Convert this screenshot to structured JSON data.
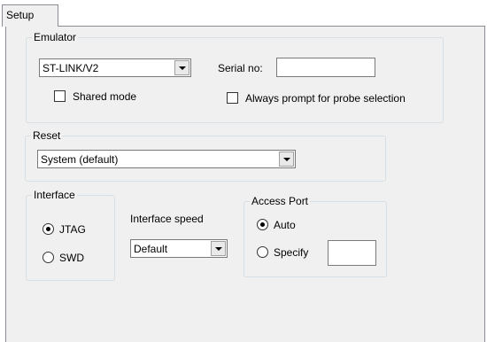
{
  "tab": {
    "label": "Setup"
  },
  "emulator": {
    "legend": "Emulator",
    "probe_value": "ST-LINK/V2",
    "serial_label": "Serial no:",
    "serial_value": "",
    "shared_mode_label": "Shared mode",
    "shared_mode_checked": false,
    "always_prompt_label": "Always prompt for probe selection",
    "always_prompt_checked": false
  },
  "reset": {
    "legend": "Reset",
    "value": "System (default)"
  },
  "interface": {
    "legend": "Interface",
    "options": [
      "JTAG",
      "SWD"
    ],
    "selected": "JTAG"
  },
  "interface_speed": {
    "label": "Interface speed",
    "value": "Default"
  },
  "access_port": {
    "legend": "Access Port",
    "options": [
      "Auto",
      "Specify"
    ],
    "selected": "Auto",
    "specify_value": ""
  }
}
